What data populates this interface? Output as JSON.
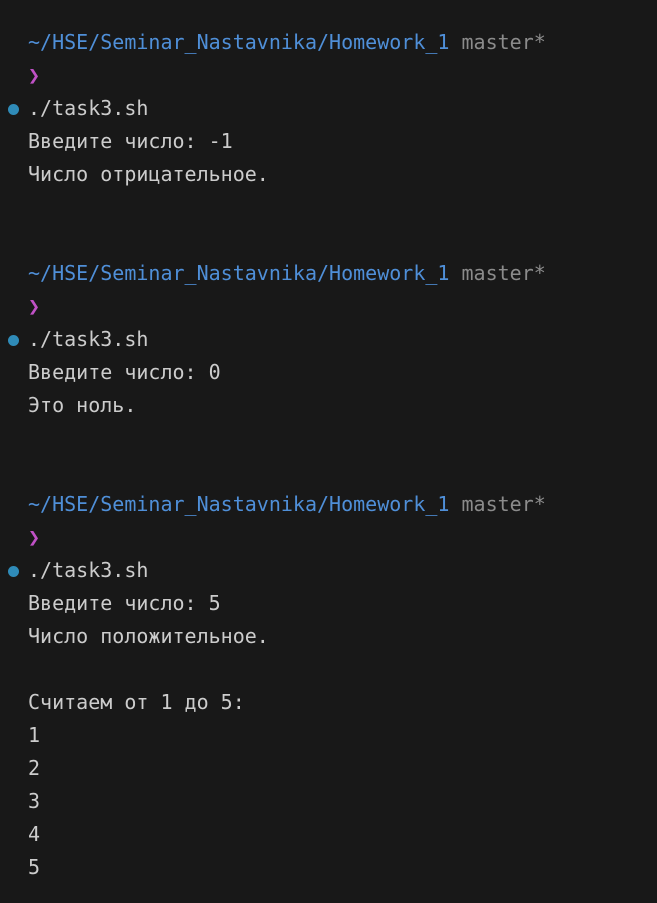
{
  "colors": {
    "background": "#181818",
    "text": "#cccccc",
    "path": "#4f8fd8",
    "branch": "#8b8b8b",
    "prompt_symbol": "#c051c6",
    "decoration_dot": "#2f8bb8"
  },
  "sessions": [
    {
      "cwd": "~/HSE/Seminar_Nastavnika/Homework_1",
      "branch": "master*",
      "prompt_symbol": "❯",
      "command": "./task3.sh",
      "decoration_icon": "command-success-dot",
      "output": [
        "Введите число: -1",
        "Число отрицательное."
      ]
    },
    {
      "cwd": "~/HSE/Seminar_Nastavnika/Homework_1",
      "branch": "master*",
      "prompt_symbol": "❯",
      "command": "./task3.sh",
      "decoration_icon": "command-success-dot",
      "output": [
        "Введите число: 0",
        "Это ноль."
      ]
    },
    {
      "cwd": "~/HSE/Seminar_Nastavnika/Homework_1",
      "branch": "master*",
      "prompt_symbol": "❯",
      "command": "./task3.sh",
      "decoration_icon": "command-success-dot",
      "output": [
        "Введите число: 5",
        "Число положительное.",
        "",
        "Считаем от 1 до 5:",
        "1",
        "2",
        "3",
        "4",
        "5"
      ]
    }
  ]
}
